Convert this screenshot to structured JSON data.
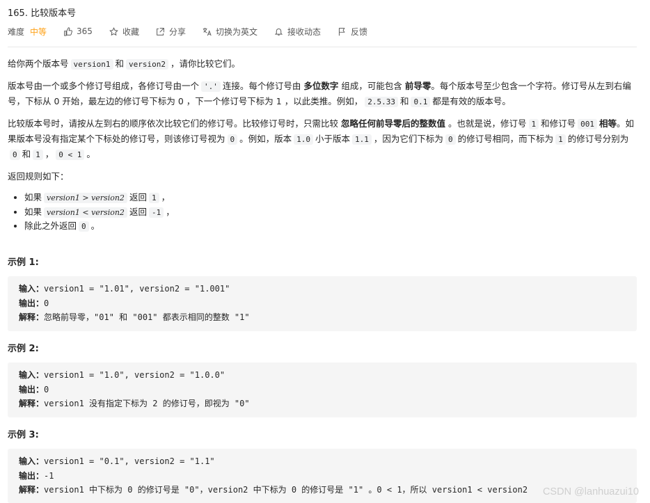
{
  "header": {
    "title": "165. 比较版本号",
    "difficulty_label": "难度",
    "difficulty_value": "中等",
    "likes": "365",
    "favorite": "收藏",
    "share": "分享",
    "translate": "切换为英文",
    "subscribe": "接收动态",
    "feedback": "反馈"
  },
  "description": {
    "p1_a": "给你两个版本号",
    "p1_code1": "version1",
    "p1_b": "和",
    "p1_code2": "version2",
    "p1_c": "，请你比较它们。",
    "p2_a": "版本号由一个或多个修订号组成，各修订号由一个",
    "p2_code": "'.'",
    "p2_b": "连接。每个修订号由",
    "p2_bold1": "多位数字",
    "p2_c": "组成，可能包含",
    "p2_bold2": "前导零",
    "p2_d": "。每个版本号至少包含一个字符。修订号从左到右编号，下标从 0 开始，最左边的修订号下标为 0 ，下一个修订号下标为 1 ，以此类推。例如，",
    "p2_code2": "2.5.33",
    "p2_e": "和",
    "p2_code3": "0.1",
    "p2_f": "都是有效的版本号。",
    "p3_a": "比较版本号时，请按从左到右的顺序依次比较它们的修订号。比较修订号时，只需比较",
    "p3_bold1": "忽略任何前导零后的整数值",
    "p3_b": "。也就是说，修订号",
    "p3_code1": "1",
    "p3_c": "和修订号",
    "p3_code2": "001",
    "p3_bold2": "相等",
    "p3_d": "。如果版本号没有指定某个下标处的修订号，则该修订号视为",
    "p3_code3": "0",
    "p3_e": "。例如，版本",
    "p3_code4": "1.0",
    "p3_f": "小于版本",
    "p3_code5": "1.1",
    "p3_g": "，因为它们下标为",
    "p3_code6": "0",
    "p3_h": "的修订号相同，而下标为",
    "p3_code7": "1",
    "p3_i": "的修订号分别为",
    "p3_code8": "0",
    "p3_j": "和",
    "p3_code9": "1",
    "p3_k": "，",
    "p3_code10": "0 < 1",
    "p3_l": "。",
    "rules_title": "返回规则如下：",
    "rules": [
      {
        "pre": "如果",
        "code": "version1 > version2",
        "mid": "返回",
        "val": "1",
        "post": "，"
      },
      {
        "pre": "如果",
        "code": "version1 < version2",
        "mid": "返回",
        "val": "-1",
        "post": "，"
      },
      {
        "pre": "除此之外返回",
        "code": "",
        "mid": "",
        "val": "0",
        "post": "。"
      }
    ]
  },
  "examples": [
    {
      "title": "示例 1:",
      "input_label": "输入：",
      "input": "version1 = \"1.01\", version2 = \"1.001\"",
      "output_label": "输出：",
      "output": "0",
      "explain_label": "解释：",
      "explain": "忽略前导零，\"01\" 和 \"001\" 都表示相同的整数 \"1\""
    },
    {
      "title": "示例 2:",
      "input_label": "输入：",
      "input": "version1 = \"1.0\", version2 = \"1.0.0\"",
      "output_label": "输出：",
      "output": "0",
      "explain_label": "解释：",
      "explain": "version1 没有指定下标为 2 的修订号，即视为 \"0\""
    },
    {
      "title": "示例 3:",
      "input_label": "输入：",
      "input": "version1 = \"0.1\", version2 = \"1.1\"",
      "output_label": "输出：",
      "output": "-1",
      "explain_label": "解释：",
      "explain": "version1 中下标为 0 的修订号是 \"0\"，version2 中下标为 0 的修订号是 \"1\" 。0 < 1，所以 version1 < version2"
    }
  ],
  "watermark": "CSDN @lanhuazui10"
}
